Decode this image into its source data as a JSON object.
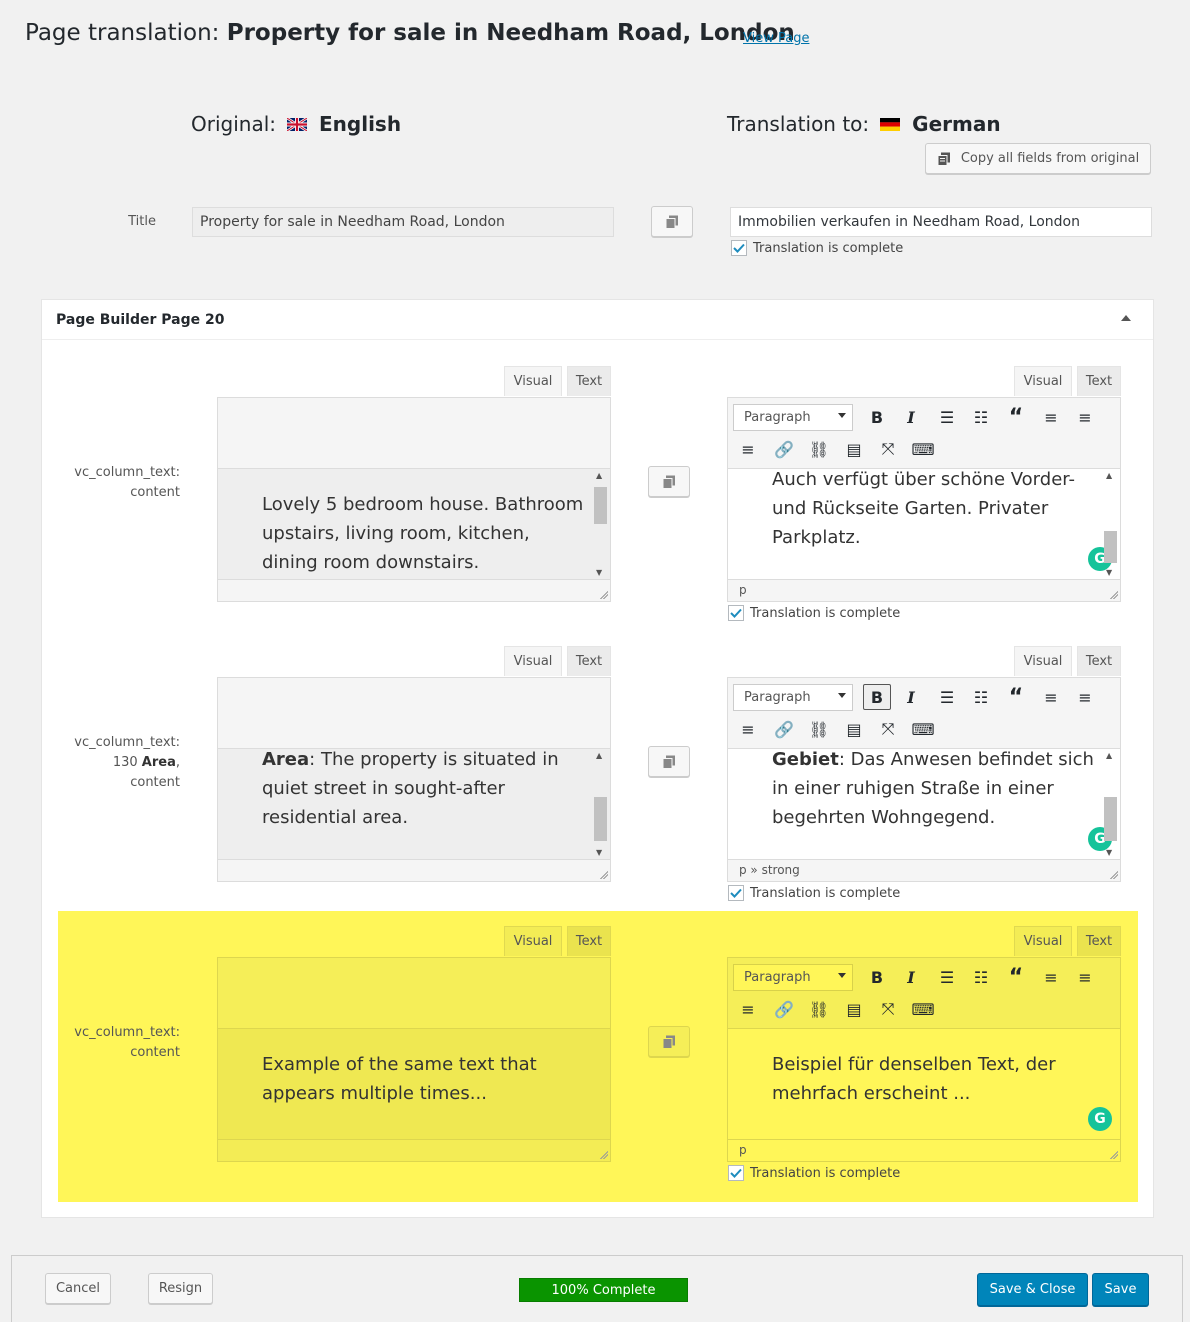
{
  "header": {
    "title_prefix": "Page translation:",
    "title_name": "Property for sale in Needham Road, London",
    "view_page": "View Page"
  },
  "languages": {
    "original_label": "Original:",
    "original_name": "English",
    "translation_label": "Translation to:",
    "translation_name": "German"
  },
  "copy_all": "Copy all fields from original",
  "title_field": {
    "label": "Title",
    "original": "Property for sale in Needham Road, London",
    "translation": "Immobilien verkaufen in Needham Road, London",
    "complete_label": "Translation is complete"
  },
  "panel": {
    "title": "Page Builder Page 20"
  },
  "editor": {
    "tab_visual": "Visual",
    "tab_text": "Text",
    "format": "Paragraph",
    "complete_label": "Translation is complete"
  },
  "blocks": [
    {
      "label": "vc_column_text: content",
      "original_text": "Lovely 5 bedroom house. Bathroom upstairs, living room, kitchen, dining room downstairs.",
      "translation_text": "Auch verfügt über schöne Vorder- und Rückseite Garten. Privater Parkplatz.",
      "path": "p"
    },
    {
      "label_prefix": "vc_column_text: 130",
      "label_bold": "Area",
      "label_suffix": ", content",
      "original_bold": "Area",
      "original_text": ": The property is situated in quiet street in sought-after residential area.",
      "translation_bold": "Gebiet",
      "translation_text": ": Das Anwesen befindet sich in einer ruhigen Straße in einer begehrten Wohngegend.",
      "path": "p » strong"
    },
    {
      "label": "vc_column_text: content",
      "original_text": "Example of the same text that appears multiple times...",
      "translation_text": "Beispiel für denselben Text, der mehrfach erscheint ...",
      "path": "p"
    }
  ],
  "footer": {
    "cancel": "Cancel",
    "resign": "Resign",
    "progress": "100% Complete",
    "save_close": "Save & Close",
    "save": "Save"
  },
  "colors": {
    "primary": "#0085ba",
    "progress": "#0a9400",
    "highlight": "#fff658",
    "link": "#0073aa",
    "grammarly": "#15c39a"
  }
}
